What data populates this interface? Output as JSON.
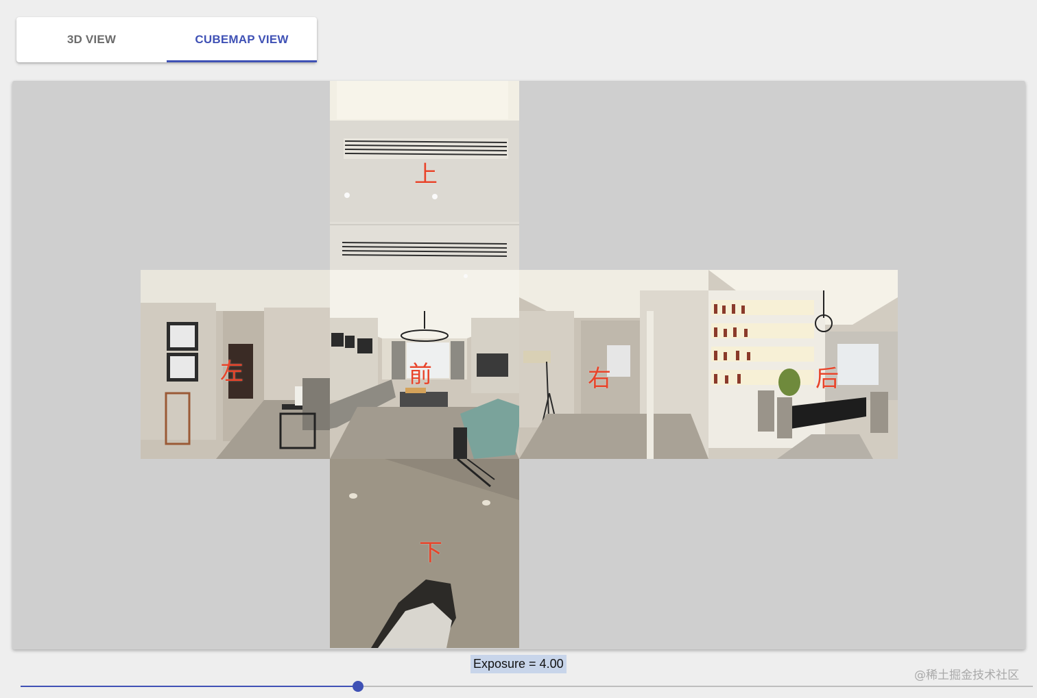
{
  "tabs": [
    {
      "label": "3D VIEW",
      "active": false
    },
    {
      "label": "CUBEMAP VIEW",
      "active": true
    }
  ],
  "cubemap": {
    "faces": {
      "top": "上",
      "left": "左",
      "front": "前",
      "right": "右",
      "back": "后",
      "bottom": "下"
    }
  },
  "exposure": {
    "label": "Exposure = 4.00",
    "value": 4.0,
    "fraction": 0.333
  },
  "watermark": "@稀土掘金技术社区",
  "colors": {
    "accent": "#3f51b5",
    "face_label": "#e8442a",
    "panel_bg": "#cfcfcf"
  }
}
